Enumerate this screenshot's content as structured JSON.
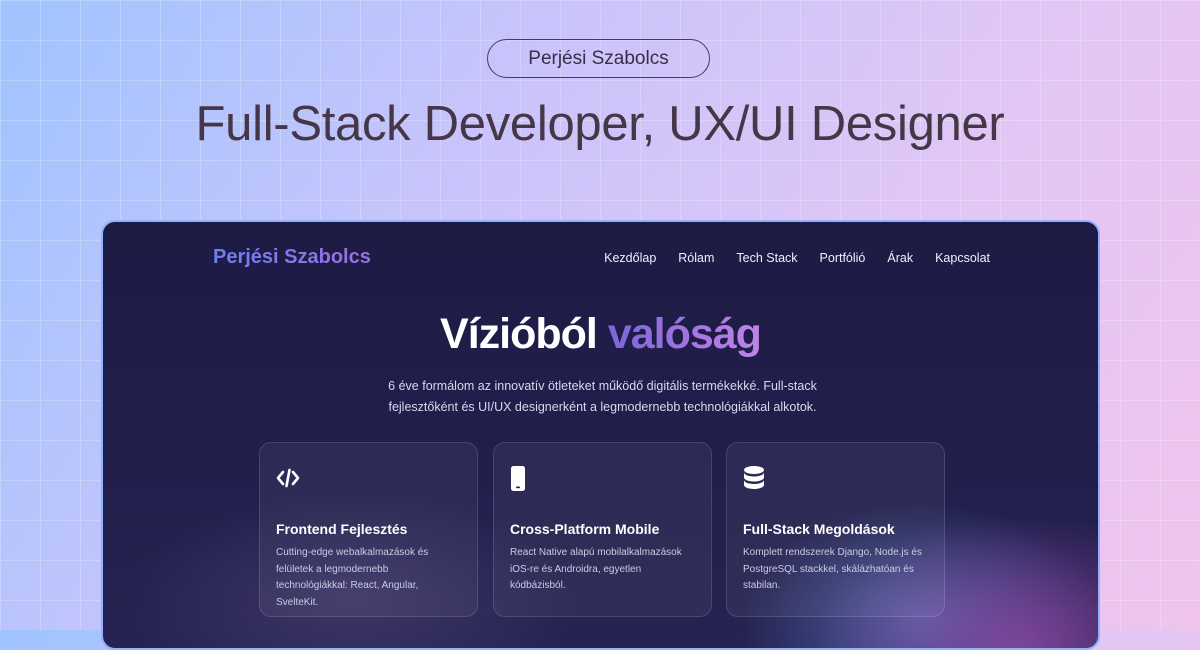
{
  "header": {
    "name_badge": "Perjési Szabolcs",
    "title": "Full-Stack Developer, UX/UI Designer"
  },
  "site": {
    "brand": "Perjési Szabolcs",
    "nav": [
      "Kezdőlap",
      "Rólam",
      "Tech Stack",
      "Portfólió",
      "Árak",
      "Kapcsolat"
    ],
    "hero": {
      "title_part1": "Vízióból",
      "title_part2": "valóság",
      "intro": "6 éve formálom az innovatív ötleteket működő digitális termékekké. Full-stack fejlesztőként és UI/UX designerként a legmodernebb technológiákkal alkotok."
    },
    "cards": [
      {
        "icon": "code-icon",
        "title": "Frontend Fejlesztés",
        "text": "Cutting-edge webalkalmazások és felületek a legmodernebb technológiákkal: React, Angular, SvelteKit."
      },
      {
        "icon": "mobile-phone-icon",
        "title": "Cross-Platform Mobile",
        "text": "React Native alapú mobilalkalmazások iOS-re és Androidra, egyetlen kódbázisból."
      },
      {
        "icon": "database-icon",
        "title": "Full-Stack Megoldások",
        "text": "Komplett rendszerek Django, Node.js és PostgreSQL stackkel, skálázhatóan és stabilan."
      }
    ]
  },
  "colors": {
    "window_bg": "#1d1b44",
    "window_border": "#8fb1ff",
    "brand_gradient": [
      "#6d7ff0",
      "#9a6fe0"
    ],
    "accent_gradient": [
      "#7b66d8",
      "#c184e8"
    ]
  }
}
